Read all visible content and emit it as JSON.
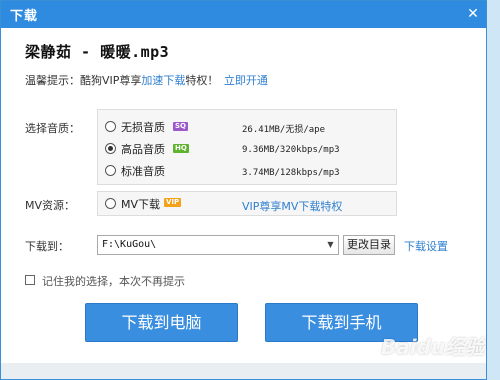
{
  "window": {
    "title": "下载",
    "close_icon": "close-icon"
  },
  "song": {
    "title": "梁静茹 - 暖暖.mp3"
  },
  "tip": {
    "prefix": "温馨提示：酷狗VIP尊享",
    "link": "加速下载",
    "suffix": "特权！",
    "action": "立即开通"
  },
  "quality": {
    "label": "选择音质：",
    "options": [
      {
        "label": "无损音质",
        "badge": "SQ",
        "spec": "26.41MB/无损/ape",
        "selected": false
      },
      {
        "label": "高品音质",
        "badge": "HQ",
        "spec": "9.36MB/320kbps/mp3",
        "selected": true
      },
      {
        "label": "标准音质",
        "badge": "",
        "spec": "3.74MB/128kbps/mp3",
        "selected": false
      }
    ]
  },
  "mv": {
    "label": "MV资源：",
    "option": "MV下载",
    "badge": "VIP",
    "link": "VIP尊享MV下载特权"
  },
  "download_to": {
    "label": "下载到：",
    "path": "F:\\KuGou\\",
    "change_button": "更改目录",
    "settings_link": "下载设置"
  },
  "remember": {
    "label": "记住我的选择，本次不再提示",
    "checked": false
  },
  "buttons": {
    "to_pc": "下载到电脑",
    "to_phone": "下载到手机"
  },
  "watermark": "Baidu经验",
  "colors": {
    "titlebar": "#2f8be0",
    "accent": "#3a8ee0",
    "link": "#2f7fd0",
    "sq_badge": "#9b59c9",
    "hq_badge": "#5fb32e",
    "vip_badge": "#f3a21a"
  }
}
